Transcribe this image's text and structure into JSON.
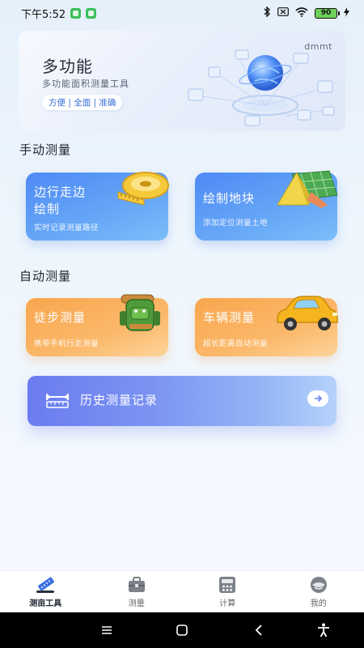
{
  "status": {
    "time": "下午5:52",
    "battery": "90"
  },
  "banner": {
    "title": "多功能",
    "subtitle": "多功能面积测量工具",
    "tags": "方便 | 全面 | 准确",
    "brand": "dmmt"
  },
  "manual": {
    "section_title": "手动测量",
    "cards": [
      {
        "title_line1": "边行走边",
        "title_line2": "绘制",
        "desc": "实时记录测量路径"
      },
      {
        "title_line1": "绘制地块",
        "desc": "添加定位测量土地"
      }
    ]
  },
  "auto": {
    "section_title": "自动测量",
    "cards": [
      {
        "title_line1": "徒步测量",
        "desc": "携带手机行走测量"
      },
      {
        "title_line1": "车辆测量",
        "desc": "超长距离自动测量"
      }
    ]
  },
  "history": {
    "label": "历史测量记录"
  },
  "nav": {
    "items": [
      {
        "label": "测亩工具",
        "icon": "ruler-icon"
      },
      {
        "label": "测量",
        "icon": "toolbox-icon"
      },
      {
        "label": "计算",
        "icon": "calculator-icon"
      },
      {
        "label": "我的",
        "icon": "profile-icon"
      }
    ]
  },
  "colors": {
    "accent_blue": "#4e8af5",
    "accent_orange": "#f8a64d",
    "history_start": "#6b7cf0"
  }
}
